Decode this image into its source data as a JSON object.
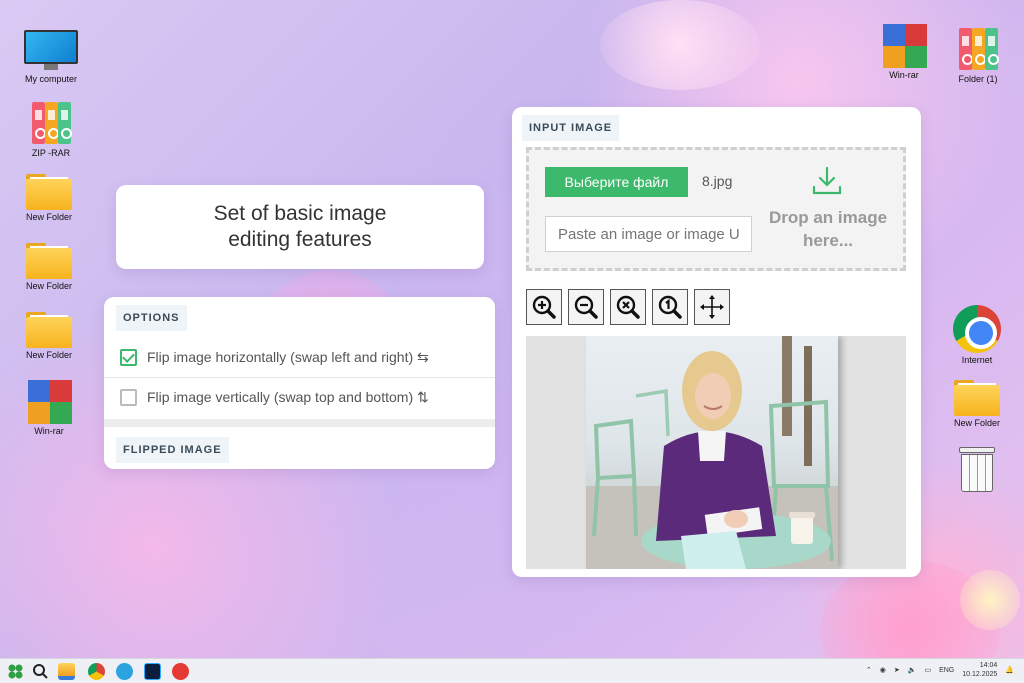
{
  "desktop": {
    "left_icons": [
      {
        "label": "My computer",
        "icon": "monitor-icon"
      },
      {
        "label": "ZIP -RAR",
        "icon": "binders-icon"
      },
      {
        "label": "New Folder",
        "icon": "folder-icon"
      },
      {
        "label": "New Folder",
        "icon": "folder-icon"
      },
      {
        "label": "New Folder",
        "icon": "folder-icon"
      },
      {
        "label": "Win-rar",
        "icon": "winrar-icon"
      }
    ],
    "right_icons": [
      {
        "label": "Win-rar",
        "icon": "winrar-icon"
      },
      {
        "label": "Folder (1)",
        "icon": "binders-icon"
      },
      {
        "label": "Internet",
        "icon": "chrome-icon"
      },
      {
        "label": "New Folder",
        "icon": "folder-icon"
      },
      {
        "label": "",
        "icon": "recycle-bin-icon"
      }
    ]
  },
  "title_card": {
    "text": "Set of basic image editing features"
  },
  "options": {
    "header": "OPTIONS",
    "flip_horizontal": {
      "label": "Flip image horizontally (swap left and right) ⇆",
      "checked": true
    },
    "flip_vertical": {
      "label": "Flip image vertically (swap top and bottom) ⇅",
      "checked": false
    },
    "flipped_header": "FLIPPED IMAGE"
  },
  "input": {
    "header": "INPUT IMAGE",
    "choose_button": "Выберите файл",
    "file_name": "8.jpg",
    "paste_placeholder": "Paste an image or image URL",
    "drop_text": "Drop an image here...",
    "tools": [
      "zoom-in-icon",
      "zoom-out-icon",
      "zoom-reset-icon",
      "zoom-actual-icon",
      "move-icon"
    ]
  },
  "taskbar": {
    "apps": [
      "windows-start-icon",
      "search-icon",
      "file-explorer-icon",
      "chrome-icon",
      "telegram-icon",
      "photoshop-icon",
      "app-icon"
    ],
    "lang": "ENG",
    "time": "14:04",
    "date": "10.12.2025"
  },
  "colors": {
    "accent_green": "#3cb96a"
  }
}
